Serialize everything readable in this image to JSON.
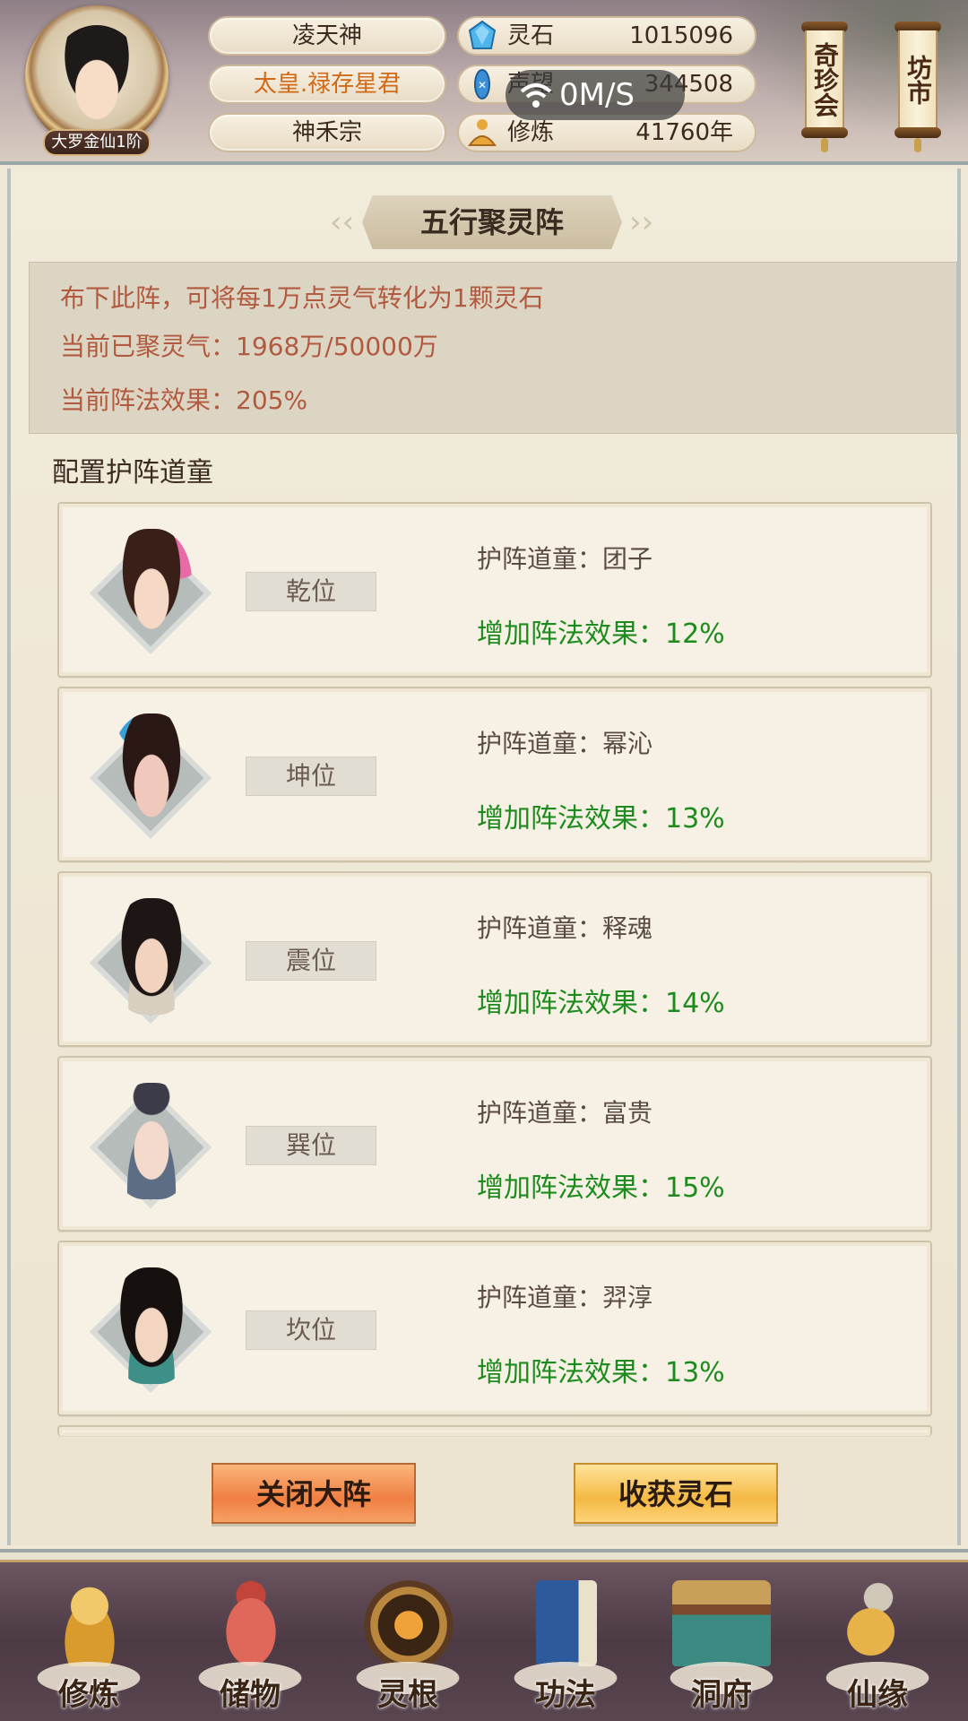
{
  "header": {
    "rank_badge": "大罗金仙1阶",
    "name_plates": [
      "凌天神",
      "太皇.禄存星君",
      "神禾宗"
    ],
    "resources": [
      {
        "icon": "spirit-stone-icon",
        "label": "灵石",
        "value": "1015096"
      },
      {
        "icon": "fame-crystal-icon",
        "label": "声望",
        "value": "344508"
      },
      {
        "icon": "meditation-icon",
        "label": "修炼",
        "value": "41760年"
      }
    ],
    "network_speed": "0M/S",
    "side_buttons": [
      {
        "label": "奇珍会"
      },
      {
        "label": "坊市"
      }
    ]
  },
  "panel": {
    "title": "五行聚灵阵",
    "info_lines": [
      "布下此阵，可将每1万点灵气转化为1颗灵石",
      "当前已聚灵气：1968万/50000万",
      "当前阵法效果：205%"
    ],
    "section_label": "配置护阵道童",
    "cards": [
      {
        "position": "乾位",
        "keeper": "护阵道童：团子",
        "bonus": "增加阵法效果：12%"
      },
      {
        "position": "坤位",
        "keeper": "护阵道童：幂沁",
        "bonus": "增加阵法效果：13%"
      },
      {
        "position": "震位",
        "keeper": "护阵道童：释魂",
        "bonus": "增加阵法效果：14%"
      },
      {
        "position": "巽位",
        "keeper": "护阵道童：富贵",
        "bonus": "增加阵法效果：15%"
      },
      {
        "position": "坎位",
        "keeper": "护阵道童：羿淳",
        "bonus": "增加阵法效果：13%"
      }
    ],
    "buttons": {
      "close": "关闭大阵",
      "harvest": "收获灵石"
    }
  },
  "nav": {
    "items": [
      {
        "label": "修炼",
        "icon": "cultivation-icon"
      },
      {
        "label": "储物",
        "icon": "storage-bag-icon"
      },
      {
        "label": "灵根",
        "icon": "spirit-root-icon"
      },
      {
        "label": "功法",
        "icon": "technique-book-icon"
      },
      {
        "label": "洞府",
        "icon": "cave-mansion-icon"
      },
      {
        "label": "仙缘",
        "icon": "immortal-fate-icon"
      }
    ]
  },
  "colors": {
    "info_text": "#b15a3f",
    "bonus_text": "#1d8b1d",
    "orange_name": "#d06a17"
  }
}
